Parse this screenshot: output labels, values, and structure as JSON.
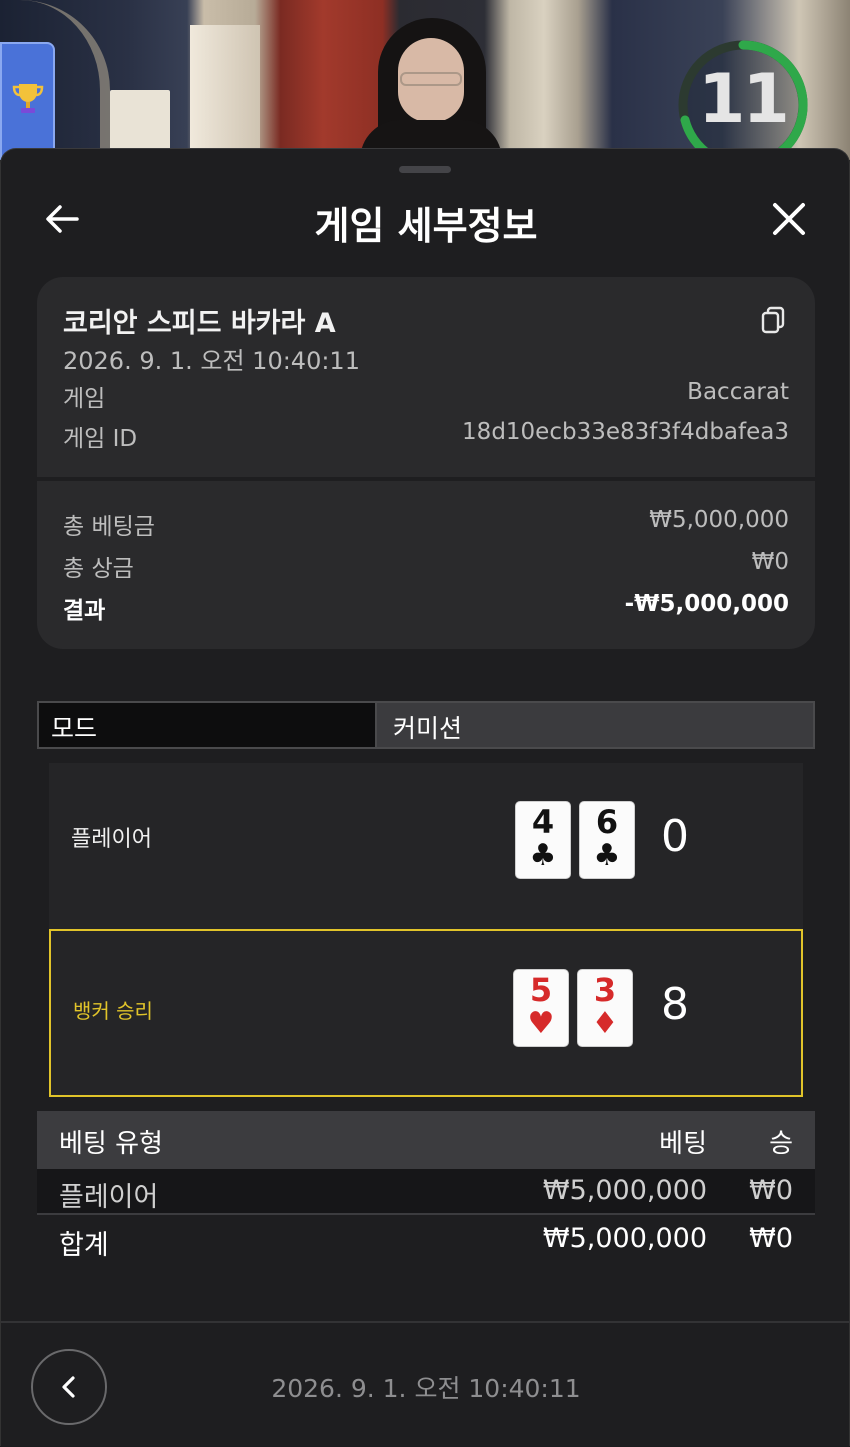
{
  "video": {
    "countdown": "11"
  },
  "header": {
    "title": "게임 세부정보"
  },
  "info": {
    "game_name": "코리안 스피드 바카라 A",
    "date": "2026. 9. 1. 오전 10:40:11",
    "rows": [
      {
        "label": "게임",
        "value": "Baccarat"
      },
      {
        "label": "게임 ID",
        "value": "18d10ecb33e83f3f4dbafea3"
      }
    ],
    "totals": [
      {
        "label": "총 베팅금",
        "value": "₩5,000,000"
      },
      {
        "label": "총 상금",
        "value": "₩0"
      },
      {
        "label": "결과",
        "value": "-₩5,000,000"
      }
    ]
  },
  "tabs": {
    "mode": "모드",
    "commission": "커미션"
  },
  "hands": {
    "player": {
      "label": "플레이어",
      "cards": [
        {
          "rank": "4",
          "suit": "♣"
        },
        {
          "rank": "6",
          "suit": "♣"
        }
      ],
      "score": "0"
    },
    "banker": {
      "label": "뱅커 승리",
      "cards": [
        {
          "rank": "5",
          "suit": "♥"
        },
        {
          "rank": "3",
          "suit": "♦"
        }
      ],
      "score": "8"
    }
  },
  "bets": {
    "headers": {
      "type": "베팅 유형",
      "bet": "베팅",
      "win": "승"
    },
    "rows": [
      {
        "type": "플레이어",
        "bet": "₩5,000,000",
        "win": "₩0"
      }
    ],
    "total": {
      "type": "합계",
      "bet": "₩5,000,000",
      "win": "₩0"
    }
  },
  "footer": {
    "date": "2026. 9. 1. 오전 10:40:11"
  },
  "colors": {
    "winner_accent": "#e1c42a",
    "timer_ring": "#2fa84a",
    "card_red": "#d62a2a"
  }
}
